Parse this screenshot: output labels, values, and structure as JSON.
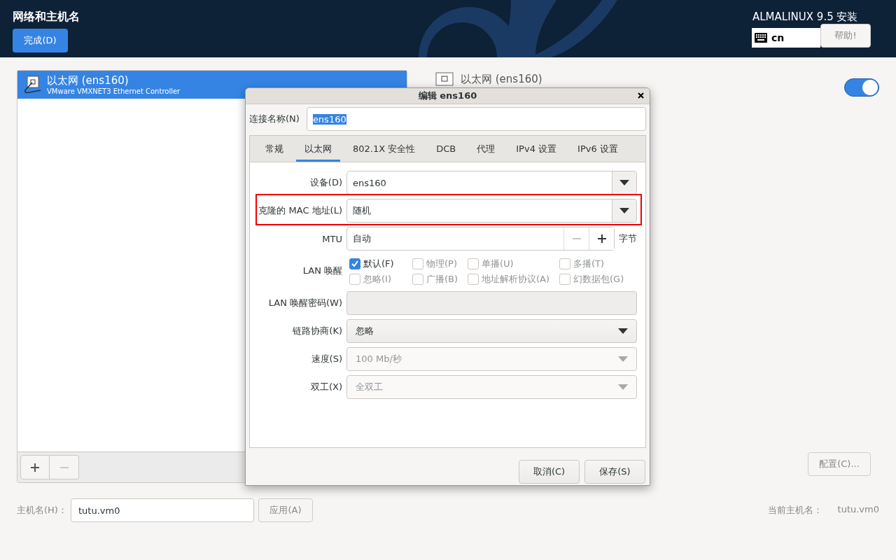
{
  "header": {
    "title": "网络和主机名",
    "done_button": "完成(D)",
    "product": "ALMALINUX 9.5 安装",
    "keyboard_layout": "cn",
    "help_button": "帮助!"
  },
  "connections": [
    {
      "name": "以太网 (ens160)",
      "description": "VMware VMXNET3 Ethernet Controller",
      "selected": true
    }
  ],
  "list_buttons": [
    {
      "kind": "add",
      "disabled": false
    },
    {
      "kind": "remove",
      "disabled": true
    }
  ],
  "device": {
    "title": "以太网 (ens160)",
    "enabled": true
  },
  "configure_button": "配置(C)...",
  "hostname": {
    "label": "主机名(H)：",
    "value": "tutu.vm0",
    "apply_button": "应用(A)"
  },
  "current_hostname": {
    "label": "当前主机名：",
    "value": "tutu.vm0"
  },
  "dialog": {
    "title": "编辑 ens160",
    "connection_name": {
      "label": "连接名称(N)",
      "value": "ens160",
      "text_selected": true
    },
    "tabs": [
      {
        "label": "常规",
        "selected": false
      },
      {
        "label": "以太网",
        "selected": true
      },
      {
        "label": "802.1X 安全性",
        "selected": false
      },
      {
        "label": "DCB",
        "selected": false
      },
      {
        "label": "代理",
        "selected": false
      },
      {
        "label": "IPv4 设置",
        "selected": false
      },
      {
        "label": "IPv6 设置",
        "selected": false
      }
    ],
    "fields": [
      {
        "kind": "combo",
        "label": "设备(D)",
        "value": "ens160",
        "highlighted": false
      },
      {
        "kind": "combo",
        "label": "克隆的 MAC 地址(L)",
        "value": "随机",
        "highlighted": true
      },
      {
        "kind": "spin",
        "label": "MTU",
        "value": "自动",
        "unit": "字节",
        "minus_disabled": true
      },
      {
        "kind": "checks",
        "label": "LAN 唤醒",
        "options": [
          {
            "label": "默认(F)",
            "checked": true,
            "disabled": false
          },
          {
            "label": "物理(P)",
            "checked": false,
            "disabled": true
          },
          {
            "label": "单播(U)",
            "checked": false,
            "disabled": true
          },
          {
            "label": "多播(T)",
            "checked": false,
            "disabled": true
          },
          {
            "label": "忽略(I)",
            "checked": false,
            "disabled": true
          },
          {
            "label": "广播(B)",
            "checked": false,
            "disabled": true
          },
          {
            "label": "地址解析协议(A)",
            "checked": false,
            "disabled": true
          },
          {
            "label": "幻数据包(G)",
            "checked": false,
            "disabled": true
          }
        ]
      },
      {
        "kind": "entry",
        "label": "LAN 唤醒密码(W)",
        "disabled": true
      },
      {
        "kind": "dropdown",
        "label": "链路协商(K)",
        "value": "忽略",
        "disabled": false
      },
      {
        "kind": "dropdown",
        "label": "速度(S)",
        "value": "100 Mb/秒",
        "disabled": true
      },
      {
        "kind": "dropdown",
        "label": "双工(X)",
        "value": "全双工",
        "disabled": true
      }
    ],
    "buttons": [
      "取消(C)",
      "保存(S)"
    ]
  }
}
